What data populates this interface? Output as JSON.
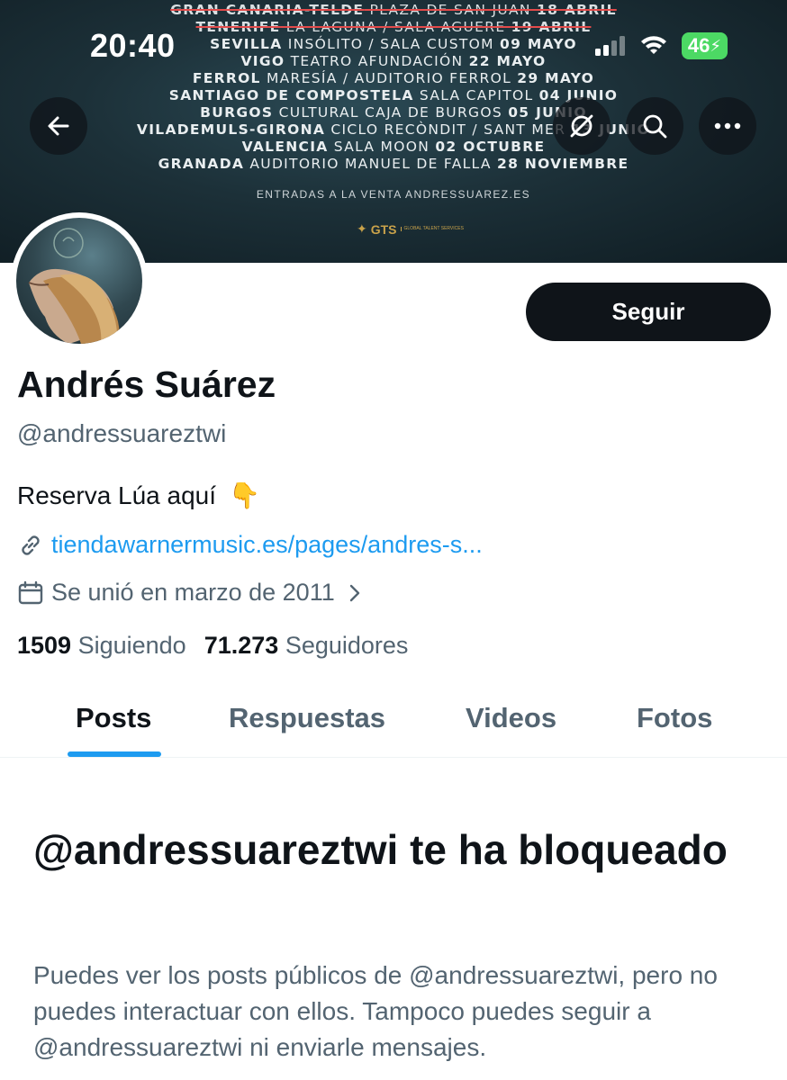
{
  "status_bar": {
    "time": "20:40",
    "battery": "46"
  },
  "banner": {
    "lines": [
      {
        "city": "GRAN CANARIA-TELDE",
        "venue": " PLAZA DE SAN JUAN ",
        "date": "18 ABRIL",
        "cancelled": true
      },
      {
        "city": "TENERIFE",
        "venue": " LA LAGUNA / SALA AGUERE ",
        "date": "19 ABRIL",
        "cancelled": true
      },
      {
        "city": "SEVILLA",
        "venue": " INSÓLITO / SALA CUSTOM ",
        "date": "09 MAYO",
        "cancelled": false
      },
      {
        "city": "VIGO",
        "venue": " TEATRO AFUNDACIÓN ",
        "date": "22 MAYO",
        "cancelled": false
      },
      {
        "city": "FERROL",
        "venue": " MARESÍA / AUDITORIO FERROL ",
        "date": "29 MAYO",
        "cancelled": false
      },
      {
        "city": "SANTIAGO DE COMPOSTELA",
        "venue": " SALA CAPITOL ",
        "date": "04 JUNIO",
        "cancelled": false
      },
      {
        "city": "BURGOS",
        "venue": " CULTURAL CAJA DE BURGOS ",
        "date": "05 JUNIO",
        "cancelled": false
      },
      {
        "city": "VILADEMULS-GIRONA",
        "venue": " CICLO RECÒNDIT / SANT MER ",
        "date": "13 JUNIO",
        "cancelled": false
      },
      {
        "city": "VALENCIA",
        "venue": " SALA MOON ",
        "date": "02 OCTUBRE",
        "cancelled": false
      },
      {
        "city": "GRANADA",
        "venue": " AUDITORIO MANUEL DE FALLA ",
        "date": "28 NOVIEMBRE",
        "cancelled": false
      }
    ],
    "footer": "ENTRADAS A LA VENTA ANDRESSUAREZ.ES",
    "logo": "GTS",
    "logo_sub": "GLOBAL TALENT SERVICES"
  },
  "profile": {
    "name": "Andrés Suárez",
    "handle": "@andressuareztwi",
    "bio": "Reserva Lúa aquí",
    "bio_emoji": "👇",
    "link": "tiendawarnermusic.es/pages/andres-s...",
    "joined": "Se unió en marzo de 2011",
    "following_count": "1509",
    "following_label": "Siguiendo",
    "followers_count": "71.273",
    "followers_label": "Seguidores",
    "follow_button": "Seguir"
  },
  "tabs": [
    {
      "label": "Posts",
      "active": true
    },
    {
      "label": "Respuestas",
      "active": false
    },
    {
      "label": "Videos",
      "active": false
    },
    {
      "label": "Fotos",
      "active": false
    }
  ],
  "blocked": {
    "title": "@andressuareztwi te ha bloqueado",
    "description": "Puedes ver los posts públicos de @andressuareztwi, pero no puedes interactuar con ellos. Tampoco puedes seguir a @andressuareztwi ni enviarle mensajes."
  },
  "colors": {
    "accent": "#1d9bf0",
    "text": "#0f1419",
    "muted": "#536471",
    "battery": "#4cd964"
  },
  "icons": [
    "back-arrow-icon",
    "no-notifications-icon",
    "search-icon",
    "more-icon",
    "link-icon",
    "calendar-icon",
    "chevron-right-icon",
    "wifi-icon",
    "signal-icon"
  ]
}
